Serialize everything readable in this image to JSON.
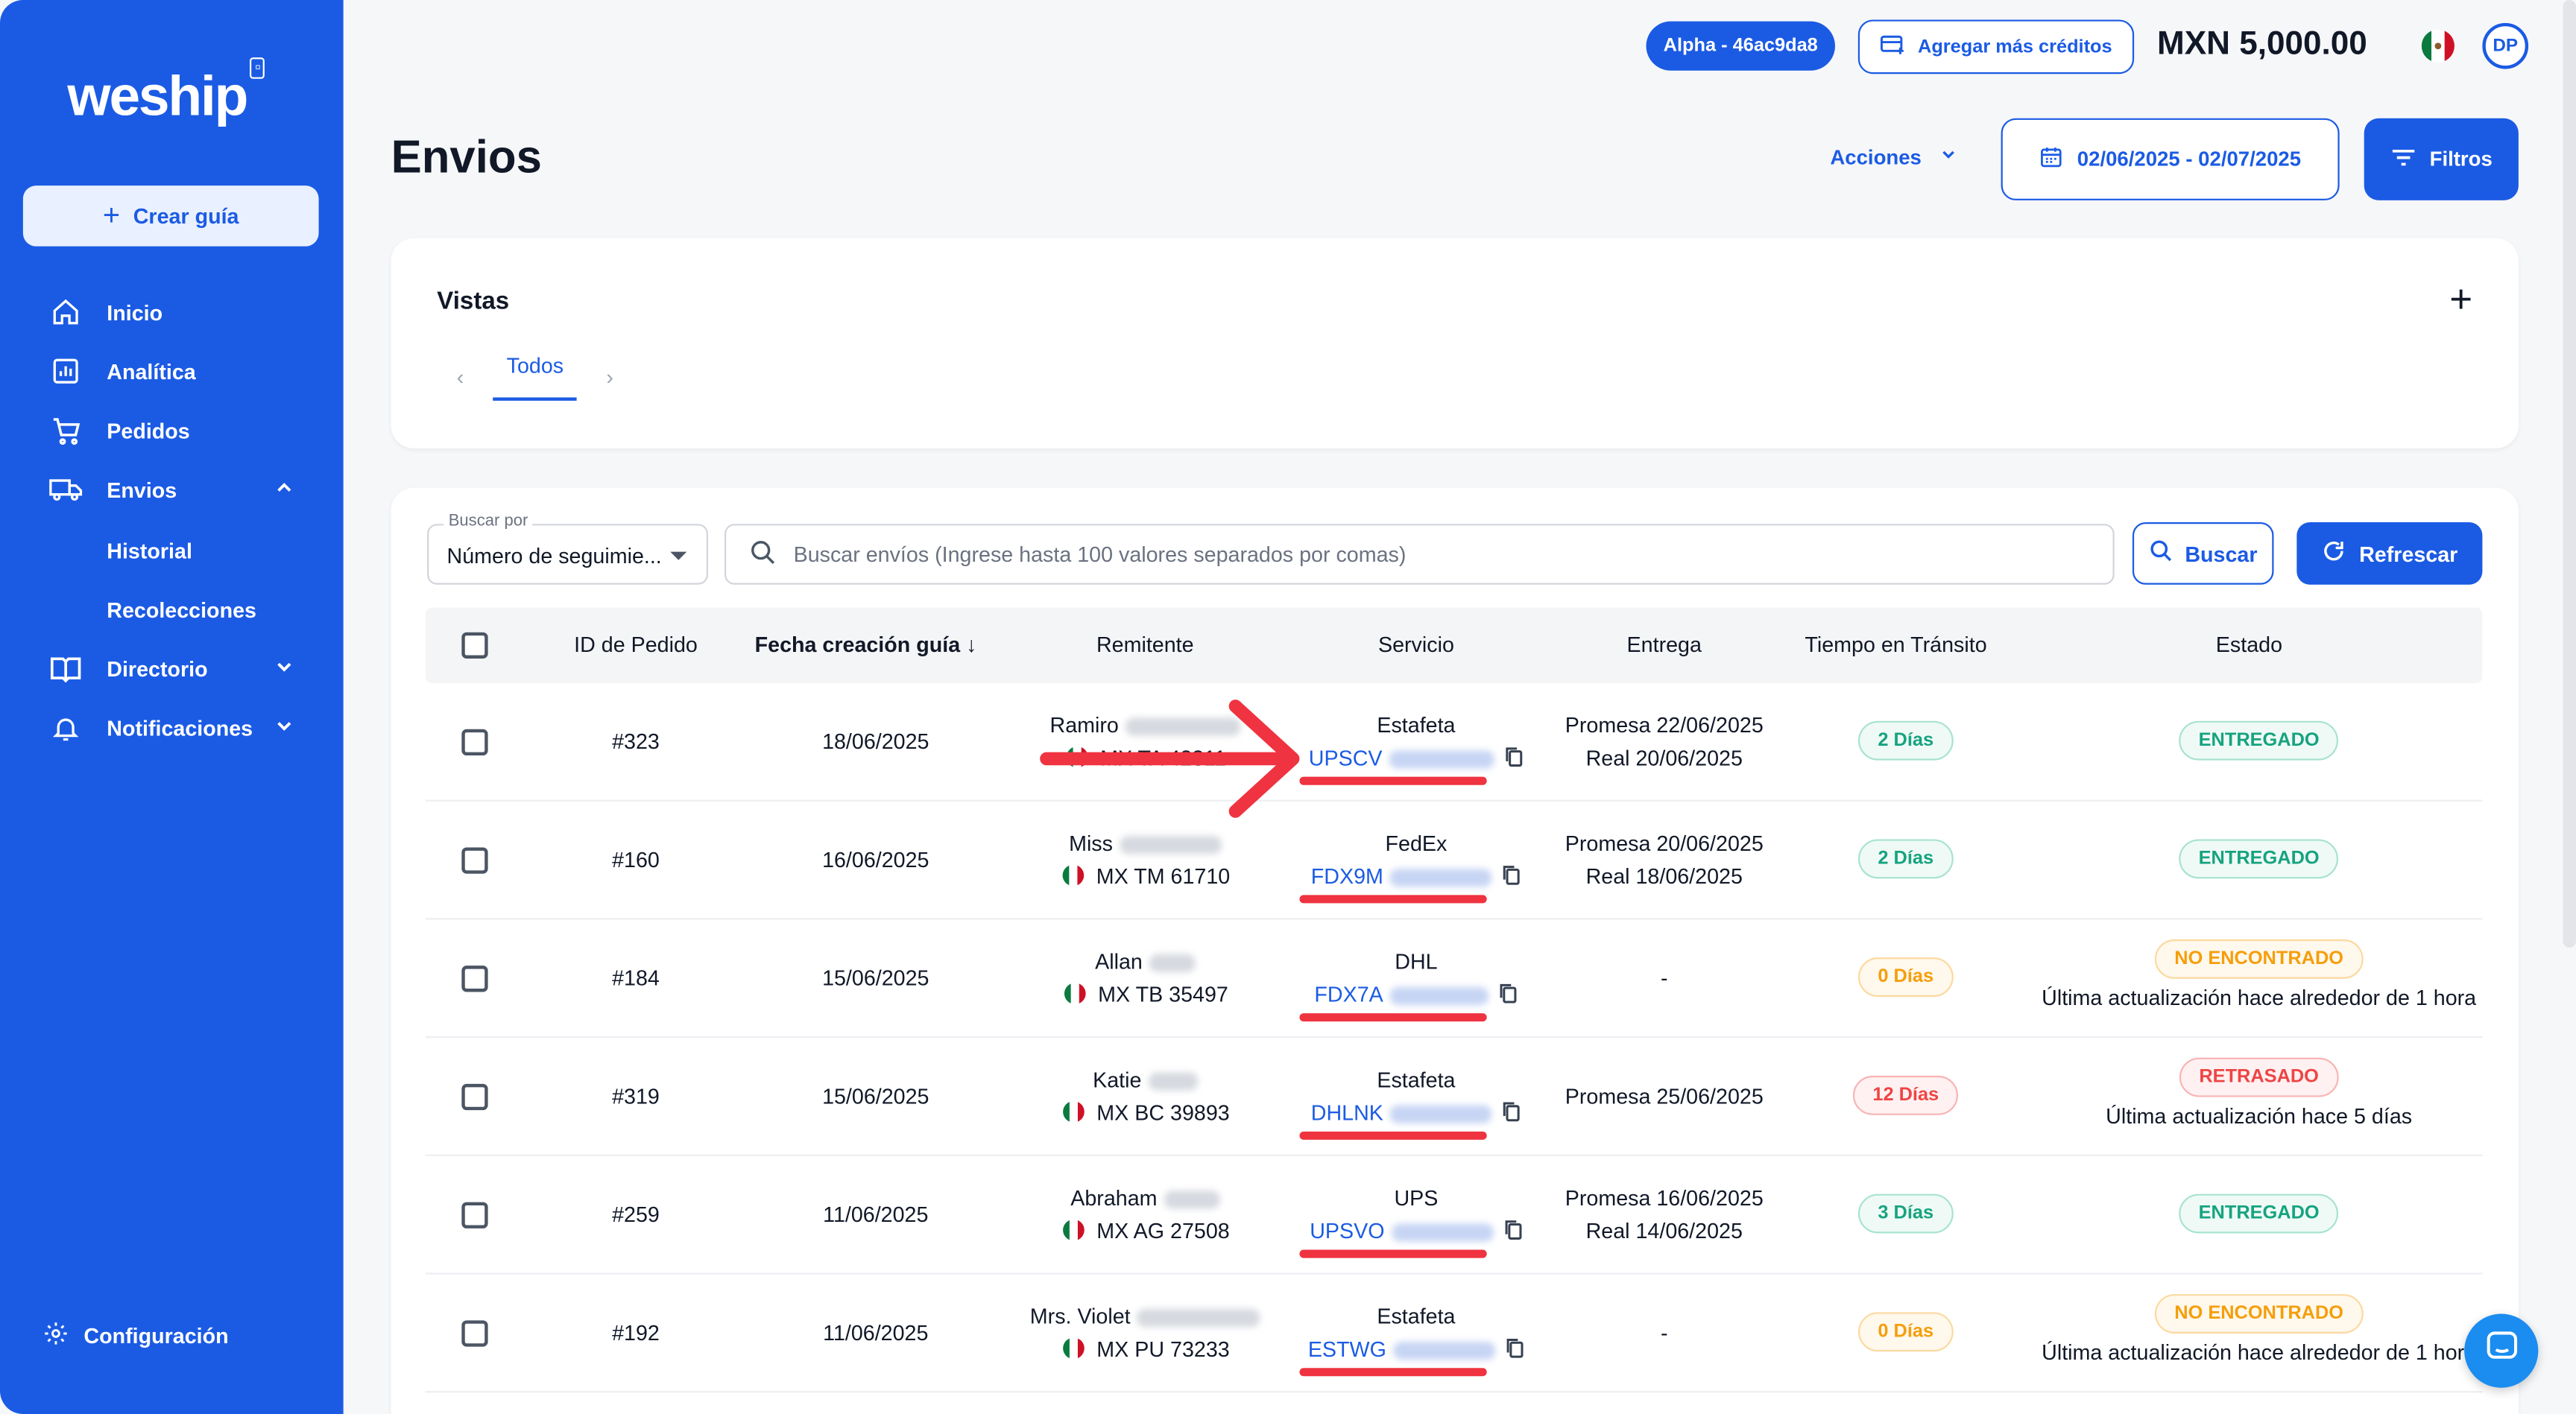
{
  "brand": {
    "name": "weship"
  },
  "sidebar": {
    "create_label": "Crear guía",
    "items": [
      {
        "label": "Inicio",
        "icon": "home-icon"
      },
      {
        "label": "Analítica",
        "icon": "analytics-icon"
      },
      {
        "label": "Pedidos",
        "icon": "cart-icon"
      },
      {
        "label": "Envios",
        "icon": "truck-icon"
      },
      {
        "label": "Directorio",
        "icon": "book-icon"
      },
      {
        "label": "Notificaciones",
        "icon": "bell-icon"
      }
    ],
    "subitems": [
      {
        "label": "Historial"
      },
      {
        "label": "Recolecciones"
      }
    ],
    "settings_label": "Configuración"
  },
  "topbar": {
    "env_badge": "Alpha - 46ac9da8",
    "credits_label": "Agregar más créditos",
    "balance": "MXN 5,000.00",
    "avatar_initials": "DP"
  },
  "page": {
    "title": "Envios",
    "actions_label": "Acciones",
    "date_range": "02/06/2025 - 02/07/2025",
    "filters_label": "Filtros"
  },
  "views": {
    "title": "Vistas",
    "tabs": [
      "Todos"
    ]
  },
  "search": {
    "by_label": "Buscar por",
    "by_value": "Número de seguimie...",
    "placeholder": "Buscar envíos (Ingrese hasta 100 valores separados por comas)",
    "search_label": "Buscar",
    "refresh_label": "Refrescar"
  },
  "table": {
    "headers": [
      "ID de Pedido",
      "Fecha creación guía",
      "Remitente",
      "Servicio",
      "Entrega",
      "Tiempo en Tránsito",
      "Estado"
    ],
    "rows": [
      {
        "id": "#323",
        "date": "18/06/2025",
        "sender": "Ramiro",
        "sender_loc": "MX TA 42311",
        "carrier": "Estafeta",
        "tracking": "UPSCV",
        "delivery1": "Promesa 22/06/2025",
        "delivery2": "Real 20/06/2025",
        "transit": "2 Días",
        "transit_color": "green",
        "status": "ENTREGADO",
        "status_color": "green",
        "status_note": ""
      },
      {
        "id": "#160",
        "date": "16/06/2025",
        "sender": "Miss",
        "sender_loc": "MX TM 61710",
        "carrier": "FedEx",
        "tracking": "FDX9M",
        "delivery1": "Promesa 20/06/2025",
        "delivery2": "Real 18/06/2025",
        "transit": "2 Días",
        "transit_color": "green",
        "status": "ENTREGADO",
        "status_color": "green",
        "status_note": ""
      },
      {
        "id": "#184",
        "date": "15/06/2025",
        "sender": "Allan",
        "sender_loc": "MX TB 35497",
        "carrier": "DHL",
        "tracking": "FDX7A",
        "delivery1": "-",
        "delivery2": "",
        "transit": "0 Días",
        "transit_color": "orange",
        "status": "NO ENCONTRADO",
        "status_color": "orange",
        "status_note": "Última actualización hace alrededor de 1 hora"
      },
      {
        "id": "#319",
        "date": "15/06/2025",
        "sender": "Katie",
        "sender_loc": "MX BC 39893",
        "carrier": "Estafeta",
        "tracking": "DHLNK",
        "delivery1": "Promesa 25/06/2025",
        "delivery2": "",
        "transit": "12 Días",
        "transit_color": "red",
        "status": "RETRASADO",
        "status_color": "red",
        "status_note": "Última actualización hace 5 días"
      },
      {
        "id": "#259",
        "date": "11/06/2025",
        "sender": "Abraham",
        "sender_loc": "MX AG 27508",
        "carrier": "UPS",
        "tracking": "UPSVO",
        "delivery1": "Promesa 16/06/2025",
        "delivery2": "Real 14/06/2025",
        "transit": "3 Días",
        "transit_color": "green",
        "status": "ENTREGADO",
        "status_color": "green",
        "status_note": ""
      },
      {
        "id": "#192",
        "date": "11/06/2025",
        "sender": "Mrs. Violet",
        "sender_loc": "MX PU 73233",
        "carrier": "Estafeta",
        "tracking": "ESTWG",
        "delivery1": "-",
        "delivery2": "",
        "transit": "0 Días",
        "transit_color": "orange",
        "status": "NO ENCONTRADO",
        "status_color": "orange",
        "status_note": "Última actualización hace alrededor de 1 hora"
      }
    ]
  },
  "colors": {
    "primary": "#1b5be4",
    "annotation": "#ef3340",
    "success": "#16a37f",
    "warning": "#f59e0b",
    "danger": "#ef4444"
  }
}
